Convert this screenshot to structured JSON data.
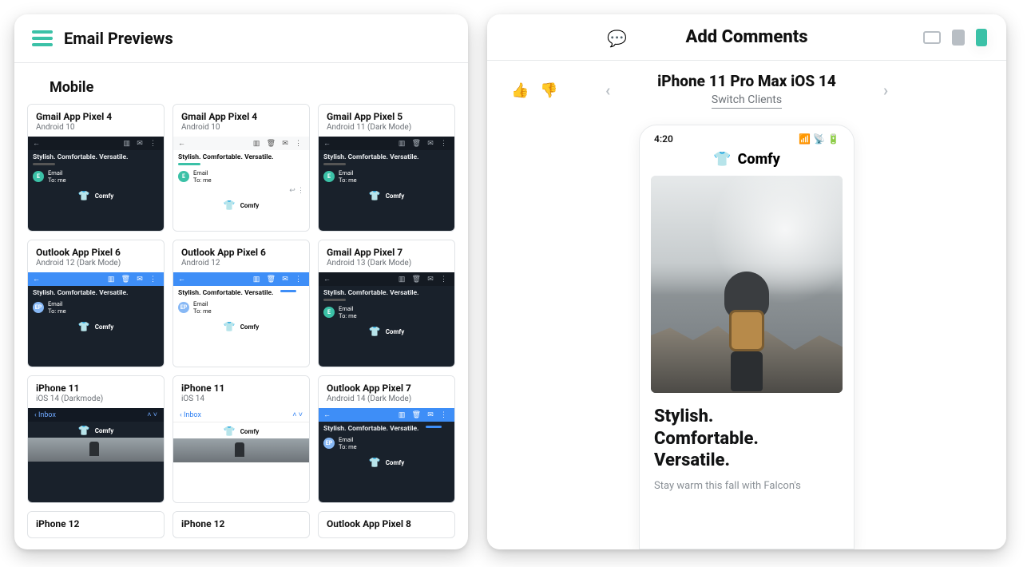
{
  "left": {
    "title": "Email Previews",
    "section": "Mobile",
    "email_subject": "Stylish. Comfortable. Versatile.",
    "brand": "Comfy",
    "sender_name": "Email",
    "sender_to": "To: me",
    "inbox_label": "Inbox",
    "cards": [
      {
        "name": "Gmail App Pixel 4",
        "sub": "Android 10",
        "style": "gmail-dark"
      },
      {
        "name": "Gmail App Pixel 4",
        "sub": "Android 10",
        "style": "gmail-light"
      },
      {
        "name": "Gmail App Pixel 5",
        "sub": "Android 11 (Dark Mode)",
        "style": "gmail-dark"
      },
      {
        "name": "Outlook App Pixel 6",
        "sub": "Android 12 (Dark Mode)",
        "style": "outlook-dark"
      },
      {
        "name": "Outlook App Pixel 6",
        "sub": "Android 12",
        "style": "outlook-light"
      },
      {
        "name": "Gmail App Pixel 7",
        "sub": "Android 13 (Dark Mode)",
        "style": "gmail-dark2"
      },
      {
        "name": "iPhone 11",
        "sub": "iOS 14 (Darkmode)",
        "style": "iphone-dark"
      },
      {
        "name": "iPhone 11",
        "sub": "iOS 14",
        "style": "iphone-light"
      },
      {
        "name": "Outlook App Pixel 7",
        "sub": "Android 14 (Dark Mode)",
        "style": "outlook-dark2"
      },
      {
        "name": "iPhone 12",
        "sub": "",
        "style": "short"
      },
      {
        "name": "iPhone 12",
        "sub": "",
        "style": "short"
      },
      {
        "name": "Outlook App Pixel 8",
        "sub": "",
        "style": "short"
      }
    ]
  },
  "right": {
    "title": "Add Comments",
    "device": "iPhone 11 Pro Max iOS 14",
    "switch_label": "Switch Clients",
    "time": "4:20",
    "brand": "Comfy",
    "headline1": "Stylish.",
    "headline2": "Comfortable.",
    "headline3": "Versatile.",
    "body_preview": "Stay warm this fall with Falcon's"
  }
}
